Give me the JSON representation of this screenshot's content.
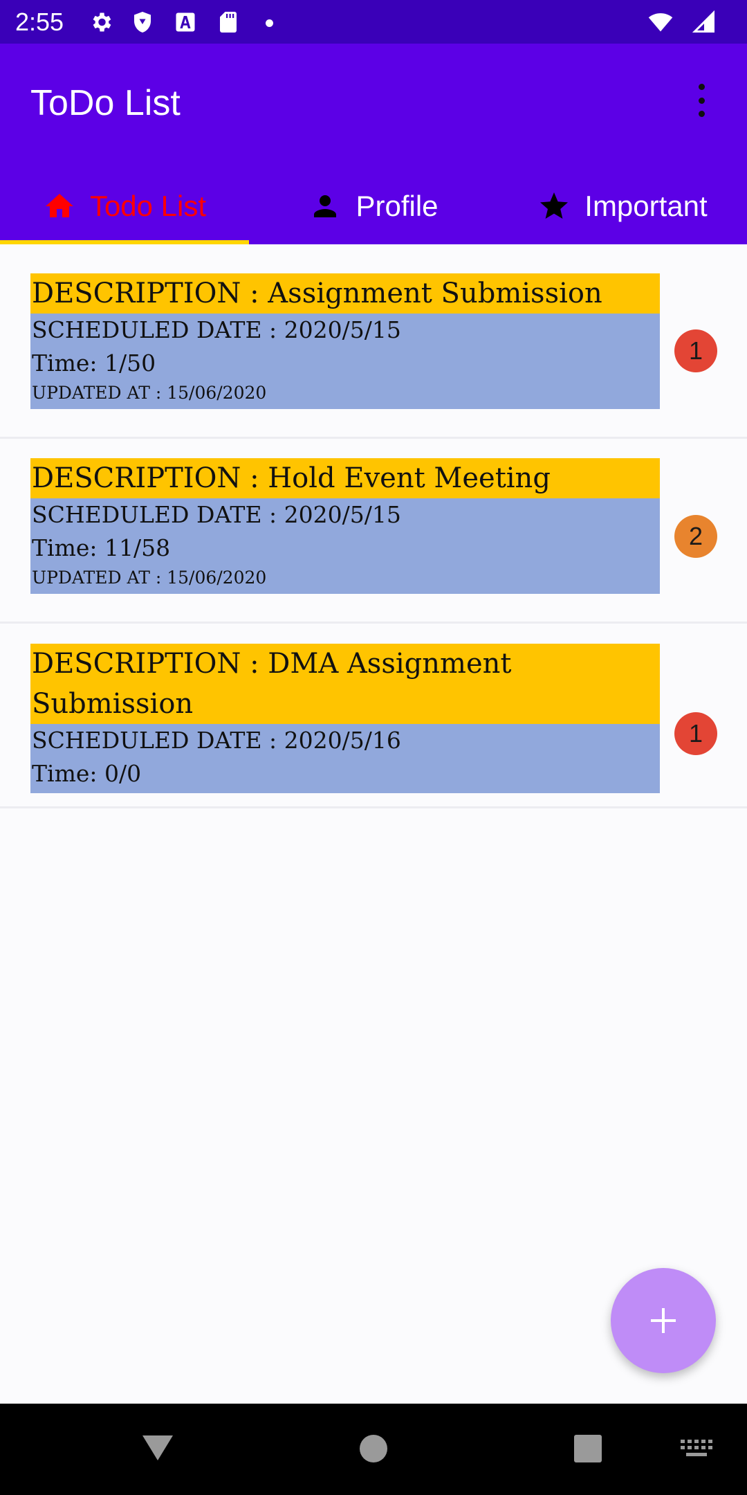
{
  "status_bar": {
    "time": "2:55",
    "icons": [
      "gear-icon",
      "shield-icon",
      "a-icon",
      "sd-card-icon",
      "dot-icon",
      "wifi-icon",
      "signal-icon"
    ]
  },
  "app_bar": {
    "title": "ToDo List",
    "menu_icon": "more-vert-icon"
  },
  "tabs": [
    {
      "label": "Todo List",
      "icon": "home-icon",
      "active": true
    },
    {
      "label": "Profile",
      "icon": "person-icon",
      "active": false
    },
    {
      "label": "Important",
      "icon": "star-icon",
      "active": false
    }
  ],
  "todos": [
    {
      "description": "DESCRIPTION : Assignment Submission",
      "scheduled": "SCHEDULED DATE : 2020/5/15",
      "time": "Time: 1/50",
      "updated": "UPDATED AT : 15/06/2020",
      "priority": "1",
      "priority_color": "#e34535"
    },
    {
      "description": "DESCRIPTION : Hold Event Meeting",
      "scheduled": "SCHEDULED DATE : 2020/5/15",
      "time": "Time: 11/58",
      "updated": "UPDATED AT : 15/06/2020",
      "priority": "2",
      "priority_color": "#e8842e"
    },
    {
      "description": "DESCRIPTION : DMA Assignment Submission",
      "scheduled": "SCHEDULED DATE : 2020/5/16",
      "time": "Time: 0/0",
      "priority": "1",
      "priority_color": "#e34535"
    }
  ],
  "fab": {
    "icon": "plus-icon",
    "color": "#bf8cf7"
  },
  "nav_bar": {
    "icons": [
      "back-icon",
      "home-circle-icon",
      "recents-icon",
      "keyboard-icon"
    ]
  },
  "colors": {
    "status_bar": "#3a00b8",
    "app_bar": "#5c00e6",
    "active_tab_text": "#ff0000",
    "tab_indicator": "#ffd600",
    "description_bg": "#ffc400",
    "card_body_bg": "#91a8dc"
  }
}
